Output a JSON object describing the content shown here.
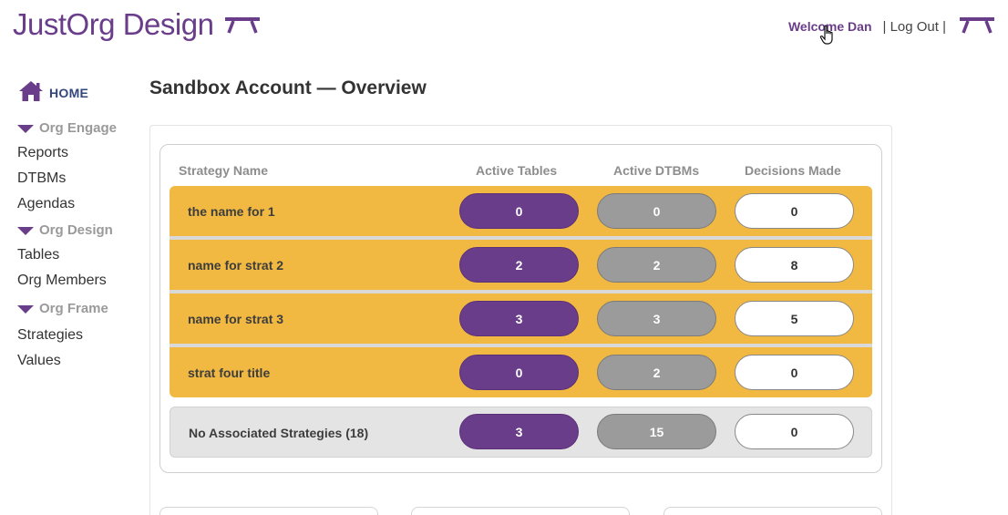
{
  "header": {
    "logo_text": "JustOrg Design",
    "welcome": "Welcome Dan",
    "logout": "| Log Out |"
  },
  "sidebar": {
    "home": "HOME",
    "sections": [
      {
        "label": "Org Engage",
        "items": [
          "Reports",
          "DTBMs",
          "Agendas"
        ]
      },
      {
        "label": "Org Design",
        "items": [
          "Tables",
          "Org Members"
        ]
      },
      {
        "label": "Org Frame",
        "items": [
          "Strategies",
          "Values"
        ]
      }
    ]
  },
  "main": {
    "title": "Sandbox Account — Overview",
    "columns": [
      "Strategy Name",
      "Active Tables",
      "Active DTBMs",
      "Decisions Made"
    ],
    "rows": [
      {
        "name": "the name for 1",
        "active_tables": "0",
        "active_dtbms": "0",
        "decisions": "0"
      },
      {
        "name": "name for strat 2",
        "active_tables": "2",
        "active_dtbms": "2",
        "decisions": "8"
      },
      {
        "name": "name for strat 3",
        "active_tables": "3",
        "active_dtbms": "3",
        "decisions": "5"
      },
      {
        "name": "strat four title",
        "active_tables": "0",
        "active_dtbms": "2",
        "decisions": "0"
      }
    ],
    "no_assoc": {
      "name": "No Associated Strategies  (18)",
      "active_tables": "3",
      "active_dtbms": "15",
      "decisions": "0"
    }
  },
  "colors": {
    "brand_purple": "#6a3d8a",
    "strategy_gold": "#f1b942",
    "dtbm_gray": "#9b9b9b",
    "home_blue": "#34477d"
  }
}
